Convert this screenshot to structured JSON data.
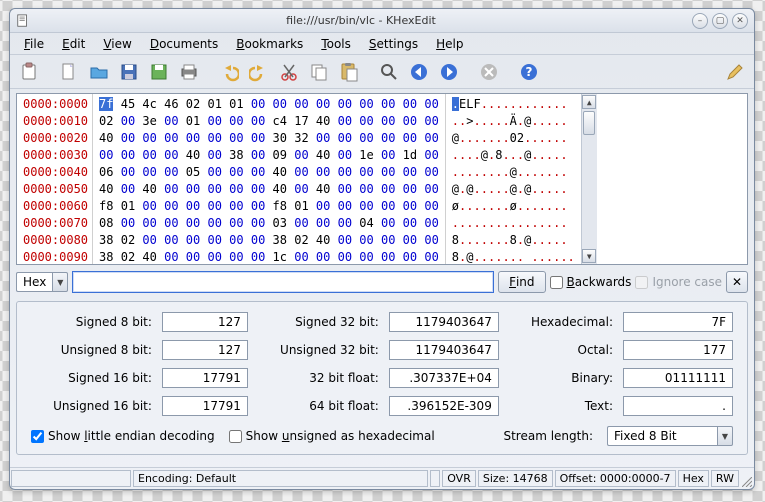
{
  "title": "file:///usr/bin/vlc - KHexEdit",
  "menus": [
    "File",
    "Edit",
    "View",
    "Documents",
    "Bookmarks",
    "Tools",
    "Settings",
    "Help"
  ],
  "hex": {
    "offsets": [
      "0000:0000",
      "0000:0010",
      "0000:0020",
      "0000:0030",
      "0000:0040",
      "0000:0050",
      "0000:0060",
      "0000:0070",
      "0000:0080",
      "0000:0090"
    ],
    "rows": [
      [
        "7f",
        "45",
        "4c",
        "46",
        "02",
        "01",
        "01",
        "00",
        "00",
        "00",
        "00",
        "00",
        "00",
        "00",
        "00",
        "00"
      ],
      [
        "02",
        "00",
        "3e",
        "00",
        "01",
        "00",
        "00",
        "00",
        "c4",
        "17",
        "40",
        "00",
        "00",
        "00",
        "00",
        "00"
      ],
      [
        "40",
        "00",
        "00",
        "00",
        "00",
        "00",
        "00",
        "00",
        "30",
        "32",
        "00",
        "00",
        "00",
        "00",
        "00",
        "00"
      ],
      [
        "00",
        "00",
        "00",
        "00",
        "40",
        "00",
        "38",
        "00",
        "09",
        "00",
        "40",
        "00",
        "1e",
        "00",
        "1d",
        "00"
      ],
      [
        "06",
        "00",
        "00",
        "00",
        "05",
        "00",
        "00",
        "00",
        "40",
        "00",
        "00",
        "00",
        "00",
        "00",
        "00",
        "00"
      ],
      [
        "40",
        "00",
        "40",
        "00",
        "00",
        "00",
        "00",
        "00",
        "40",
        "00",
        "40",
        "00",
        "00",
        "00",
        "00",
        "00"
      ],
      [
        "f8",
        "01",
        "00",
        "00",
        "00",
        "00",
        "00",
        "00",
        "f8",
        "01",
        "00",
        "00",
        "00",
        "00",
        "00",
        "00"
      ],
      [
        "08",
        "00",
        "00",
        "00",
        "00",
        "00",
        "00",
        "00",
        "03",
        "00",
        "00",
        "00",
        "04",
        "00",
        "00",
        "00"
      ],
      [
        "38",
        "02",
        "00",
        "00",
        "00",
        "00",
        "00",
        "00",
        "38",
        "02",
        "40",
        "00",
        "00",
        "00",
        "00",
        "00"
      ],
      [
        "38",
        "02",
        "40",
        "00",
        "00",
        "00",
        "00",
        "00",
        "1c",
        "00",
        "00",
        "00",
        "00",
        "00",
        "00",
        "00"
      ]
    ],
    "ascii": [
      ".ELF............",
      "..>.....Ä.@.....",
      "@.......02......",
      "....@.8...@.....",
      "........@.......",
      "@.@.....@.@.....",
      "ø.......ø.......",
      "................",
      "8.......8.@.....",
      "8.@....... ......"
    ]
  },
  "find": {
    "mode": "Hex",
    "button": "Find",
    "backwards_label": "Backwards",
    "ignore_label": "Ignore case"
  },
  "info": {
    "s8_label": "Signed 8 bit:",
    "s8": "127",
    "u8_label": "Unsigned 8 bit:",
    "u8": "127",
    "s16_label": "Signed 16 bit:",
    "s16": "17791",
    "u16_label": "Unsigned 16 bit:",
    "u16": "17791",
    "s32_label": "Signed 32 bit:",
    "s32": "1179403647",
    "u32_label": "Unsigned 32 bit:",
    "u32": "1179403647",
    "f32_label": "32 bit float:",
    "f32": ".307337E+04",
    "f64_label": "64 bit float:",
    "f64": ".396152E-309",
    "hex_label": "Hexadecimal:",
    "hex": "7F",
    "oct_label": "Octal:",
    "oct": "177",
    "bin_label": "Binary:",
    "bin": "01111111",
    "txt_label": "Text:",
    "txt": ".",
    "little_endian_label": "Show little endian decoding",
    "unsigned_hex_label": "Show unsigned as hexadecimal",
    "stream_label": "Stream length:",
    "stream_value": "Fixed 8 Bit"
  },
  "status": {
    "encoding": "Encoding: Default",
    "ovr": "OVR",
    "size": "Size: 14768",
    "offset": "Offset: 0000:0000-7",
    "hex": "Hex",
    "rw": "RW"
  }
}
